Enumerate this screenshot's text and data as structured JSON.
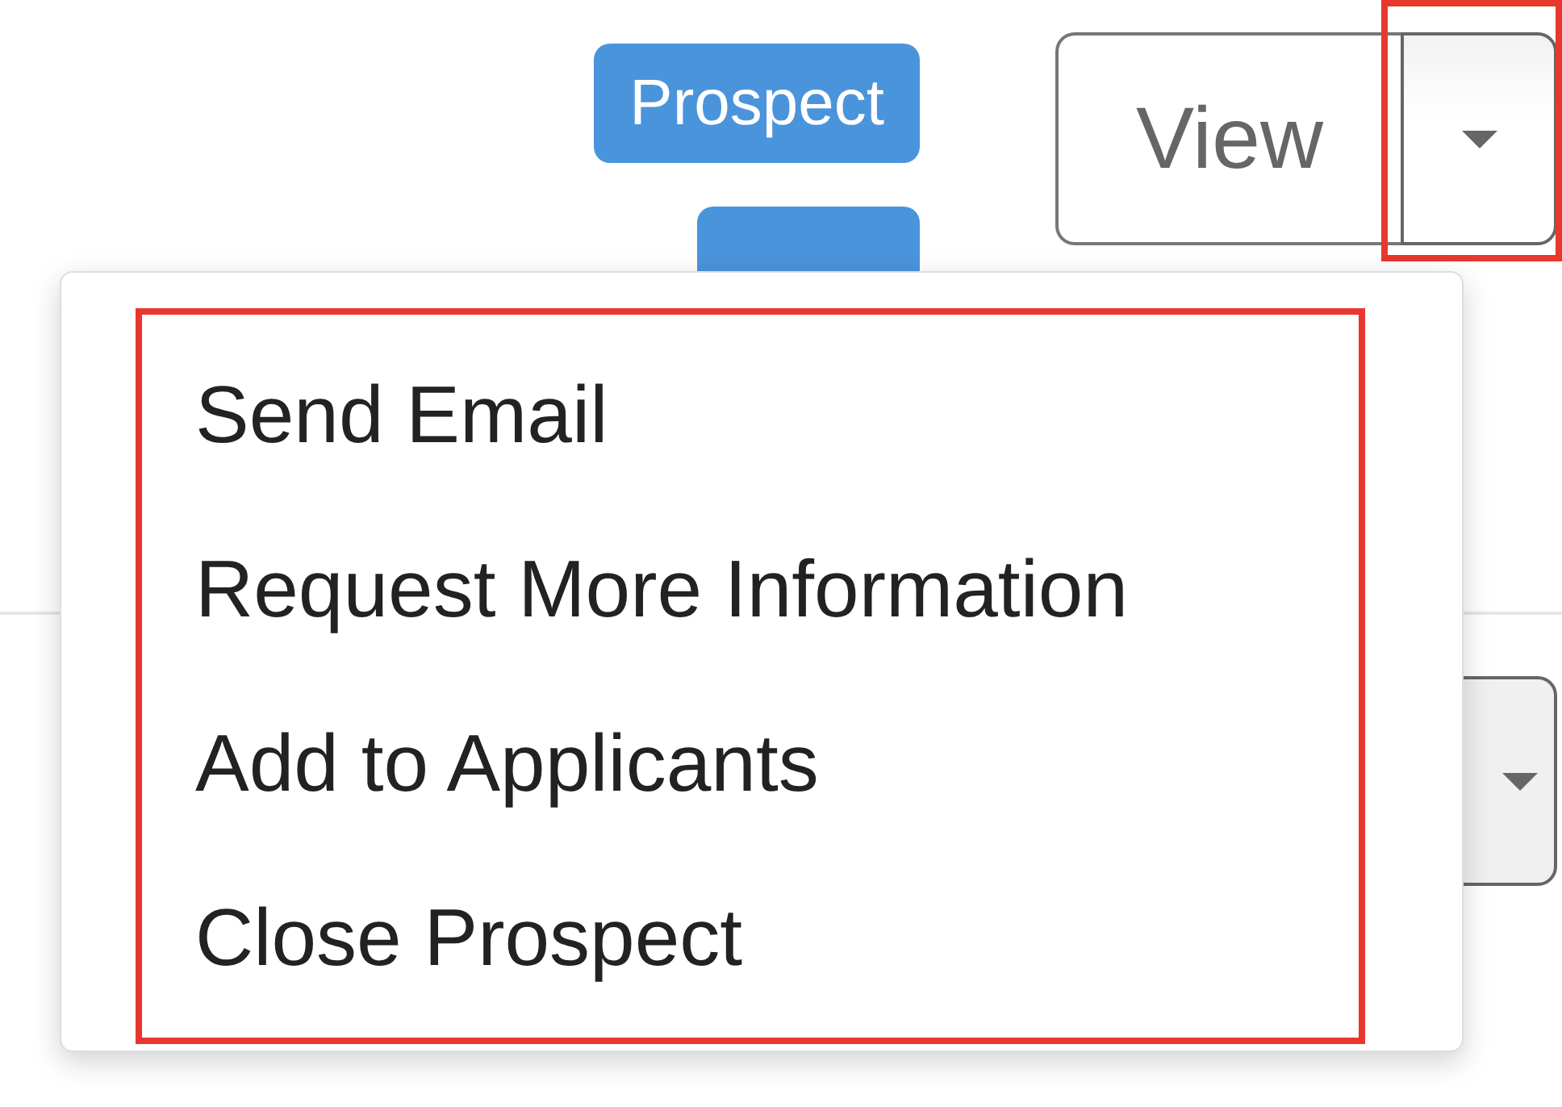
{
  "status_tags": [
    {
      "kind": "label",
      "label": "Prospect"
    },
    {
      "kind": "covered"
    }
  ],
  "view_button": {
    "label": "View",
    "toggle": {
      "highlight": true
    }
  },
  "second_toggle": {
    "visible": true
  },
  "dropdown_menu": {
    "highlight": true,
    "items": [
      {
        "label": "Send Email"
      },
      {
        "label": "Request More Information"
      },
      {
        "label": "Add to Applicants"
      },
      {
        "label": "Close Prospect"
      }
    ]
  }
}
